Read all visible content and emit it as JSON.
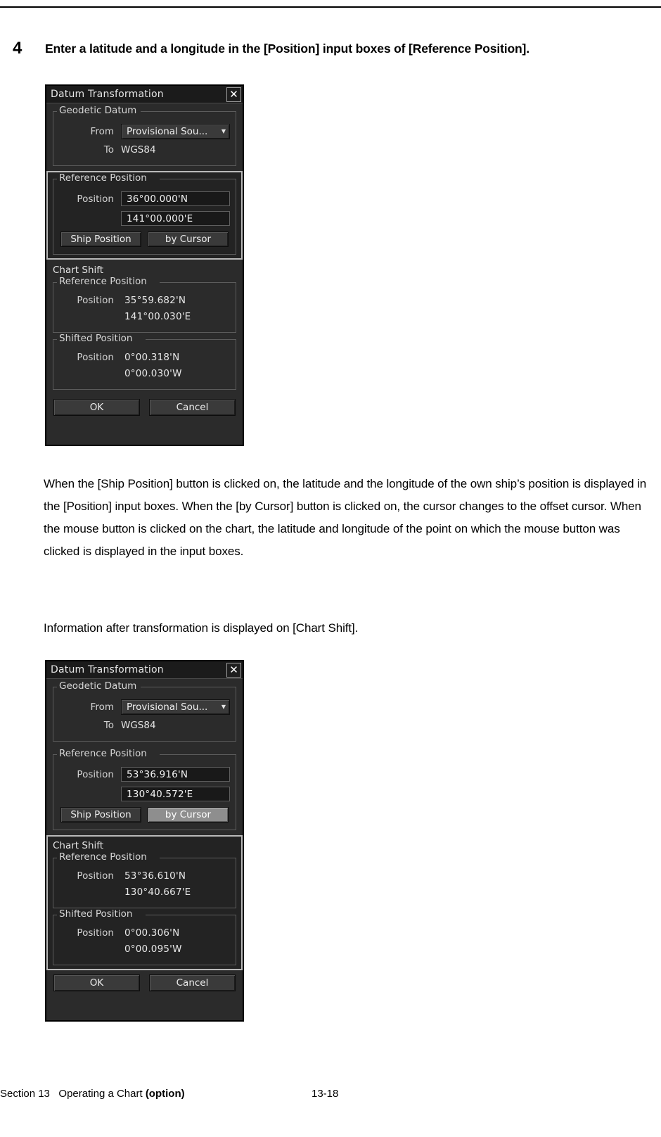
{
  "step": {
    "number": "4",
    "text": "Enter a latitude and a longitude in the [Position] input boxes of [Reference Position]."
  },
  "paragraphs": {
    "block1": "When the [Ship Position] button is clicked on, the latitude and the longitude of the own ship’s position is displayed in the [Position] input boxes. When the [by Cursor] button is clicked on, the cursor changes to the offset cursor. When the mouse button is clicked on the chart, the latitude and longitude of the point on which the mouse button was clicked is displayed in the input boxes.",
    "block2": "Information after transformation is displayed on [Chart Shift]."
  },
  "footer": {
    "section": "Section 13",
    "chapter": "Operating a Chart",
    "option": "(option)",
    "page": "13-18"
  },
  "dialog1": {
    "title": "Datum Transformation",
    "close_icon": "✕",
    "geodetic_datum": {
      "group_label": "Geodetic Datum",
      "from_label": "From",
      "from_value": "Provisional Sou...",
      "dropdown_arrow": "▼",
      "to_label": "To",
      "to_value": "WGS84"
    },
    "reference_position": {
      "group_label": "Reference Position",
      "position_label": "Position",
      "latitude": "36°00.000'N",
      "longitude": "141°00.000'E",
      "ship_position_button": "Ship Position",
      "by_cursor_button": "by Cursor",
      "active": true,
      "by_cursor_highlighted": false
    },
    "chart_shift": {
      "heading": "Chart Shift",
      "active": false,
      "reference_position": {
        "group_label": "Reference Position",
        "position_label": "Position",
        "latitude": "35°59.682'N",
        "longitude": "141°00.030'E"
      },
      "shifted_position": {
        "group_label": "Shifted Position",
        "position_label": "Position",
        "latitude": "0°00.318'N",
        "longitude": "0°00.030'W"
      }
    },
    "ok_button": "OK",
    "cancel_button": "Cancel"
  },
  "dialog2": {
    "title": "Datum Transformation",
    "close_icon": "✕",
    "geodetic_datum": {
      "group_label": "Geodetic Datum",
      "from_label": "From",
      "from_value": "Provisional Sou...",
      "dropdown_arrow": "▼",
      "to_label": "To",
      "to_value": "WGS84"
    },
    "reference_position": {
      "group_label": "Reference Position",
      "position_label": "Position",
      "latitude": "53°36.916'N",
      "longitude": "130°40.572'E",
      "ship_position_button": "Ship Position",
      "by_cursor_button": "by Cursor",
      "active": false,
      "by_cursor_highlighted": true
    },
    "chart_shift": {
      "heading": "Chart Shift",
      "active": true,
      "reference_position": {
        "group_label": "Reference Position",
        "position_label": "Position",
        "latitude": "53°36.610'N",
        "longitude": "130°40.667'E"
      },
      "shifted_position": {
        "group_label": "Shifted Position",
        "position_label": "Position",
        "latitude": "0°00.306'N",
        "longitude": "0°00.095'W"
      }
    },
    "ok_button": "OK",
    "cancel_button": "Cancel"
  },
  "colors": {
    "dialog_bg": "#2b2b2b",
    "titlebar_bg": "#1b1b1b",
    "input_bg": "#191919",
    "button_bg": "#3a3a3a",
    "highlight_button_bg": "#8e8e8e",
    "active_border": "#b9b9b9",
    "text": "#d8d8d8"
  }
}
